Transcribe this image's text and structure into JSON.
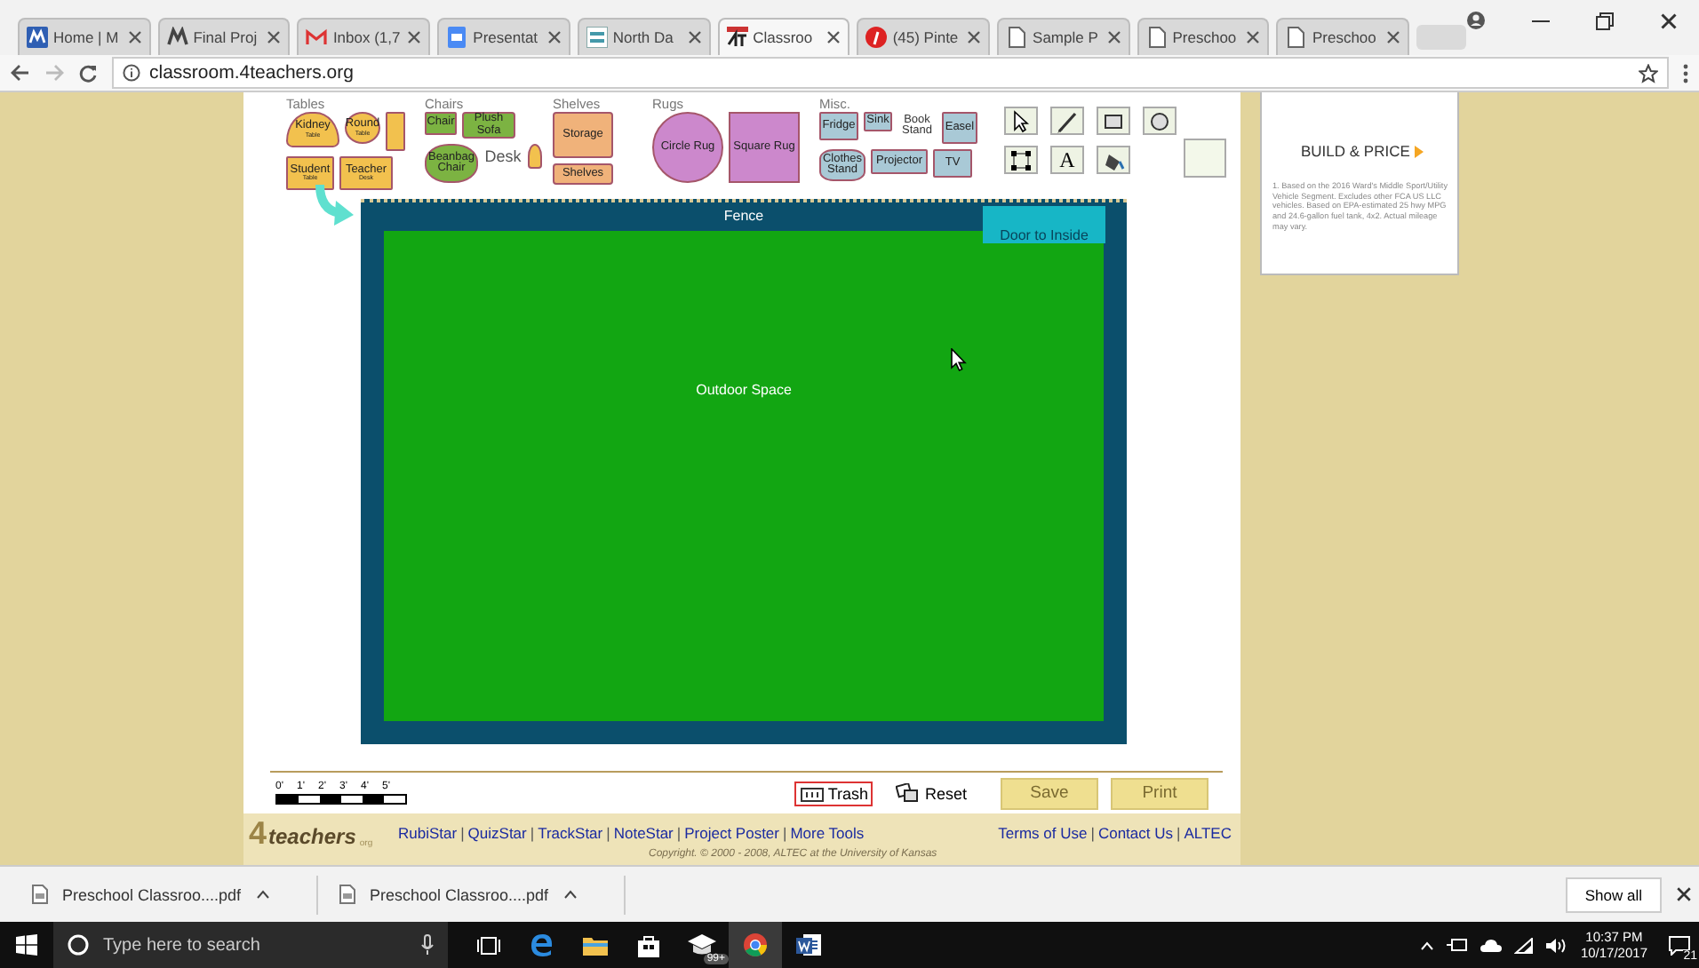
{
  "browser": {
    "tabs": [
      {
        "title": "Home | M",
        "selected": false
      },
      {
        "title": "Final Proj",
        "selected": false
      },
      {
        "title": "Inbox (1,7",
        "selected": false
      },
      {
        "title": "Presentat",
        "selected": false
      },
      {
        "title": "North Da",
        "selected": false
      },
      {
        "title": "Classroo",
        "selected": true
      },
      {
        "title": "(45) Pinte",
        "selected": false
      },
      {
        "title": "Sample P",
        "selected": false
      },
      {
        "title": "Preschoo",
        "selected": false
      },
      {
        "title": "Preschoo",
        "selected": false
      }
    ],
    "url": "classroom.4teachers.org"
  },
  "palette": {
    "categories": [
      {
        "label": "Tables",
        "pieces": [
          {
            "kind": "kidney-table",
            "label": "Kidney",
            "sublabel": "Table"
          },
          {
            "kind": "round-table",
            "label": "Round",
            "sublabel": "Table"
          },
          {
            "kind": "computer-table"
          },
          {
            "kind": "student-table",
            "label": "Student",
            "sublabel": "Table"
          },
          {
            "kind": "teacher-desk",
            "label": "Teacher",
            "sublabel": "Desk"
          }
        ]
      },
      {
        "label": "Chairs",
        "pieces": [
          {
            "kind": "chair",
            "label": "Chair"
          },
          {
            "kind": "sofa",
            "label": "Plush Sofa"
          },
          {
            "kind": "beanbag",
            "label": "Beanbag Chair"
          },
          {
            "kind": "desk",
            "label": "Desk"
          },
          {
            "kind": "rocker"
          }
        ]
      },
      {
        "label": "Shelves",
        "pieces": [
          {
            "kind": "storage",
            "label": "Storage"
          },
          {
            "kind": "shelves",
            "label": "Shelves"
          }
        ]
      },
      {
        "label": "Rugs",
        "pieces": [
          {
            "kind": "circle-rug",
            "label": "Circle Rug"
          },
          {
            "kind": "square-rug",
            "label": "Square Rug"
          }
        ]
      },
      {
        "label": "Misc.",
        "pieces": [
          {
            "kind": "fridge",
            "label": "Fridge"
          },
          {
            "kind": "sink",
            "label": "Sink"
          },
          {
            "kind": "book-stand",
            "label": "Book Stand"
          },
          {
            "kind": "easel",
            "label": "Easel"
          },
          {
            "kind": "clothes-stand",
            "label": "Clothes Stand"
          },
          {
            "kind": "projector",
            "label": "Projector"
          },
          {
            "kind": "tv",
            "label": "TV"
          }
        ]
      }
    ],
    "tools": [
      {
        "kind": "pointer"
      },
      {
        "kind": "brush"
      },
      {
        "kind": "rectangle"
      },
      {
        "kind": "ellipse"
      },
      {
        "kind": "select"
      },
      {
        "kind": "text",
        "label": "A"
      },
      {
        "kind": "fill"
      }
    ]
  },
  "canvas": {
    "fence_label": "Fence",
    "door_label": "Door to Inside",
    "area_label": "Outdoor Space"
  },
  "scale": {
    "labels": [
      "0'",
      "1'",
      "2'",
      "3'",
      "4'",
      "5'"
    ]
  },
  "actions": [
    {
      "kind": "trash",
      "label": "Trash"
    },
    {
      "kind": "reset",
      "label": "Reset"
    },
    {
      "kind": "button",
      "label": "Save"
    },
    {
      "kind": "button",
      "label": "Print"
    }
  ],
  "footer": {
    "logo": {
      "numeral": "4",
      "word": "teachers",
      "suffix": "org"
    },
    "nav": [
      {
        "kind": "link",
        "label": "RubiStar"
      },
      {
        "kind": "separator",
        "label": "|"
      },
      {
        "kind": "link",
        "label": "QuizStar"
      },
      {
        "kind": "separator",
        "label": "|"
      },
      {
        "kind": "link",
        "label": "TrackStar"
      },
      {
        "kind": "separator",
        "label": "|"
      },
      {
        "kind": "link",
        "label": "NoteStar"
      },
      {
        "kind": "separator",
        "label": "|"
      },
      {
        "kind": "link",
        "label": "Project Poster"
      },
      {
        "kind": "separator",
        "label": "|"
      },
      {
        "kind": "link",
        "label": "More Tools"
      }
    ],
    "right_nav": [
      {
        "kind": "link",
        "label": "Terms of Use"
      },
      {
        "kind": "separator",
        "label": "|"
      },
      {
        "kind": "link",
        "label": "Contact Us"
      },
      {
        "kind": "separator",
        "label": "|"
      },
      {
        "kind": "link",
        "label": "ALTEC"
      }
    ],
    "copyright": "Copyright. © 2000 - 2008, ALTEC at the University of Kansas"
  },
  "ad": {
    "heading": "BUILD & PRICE",
    "fine_print": "1. Based on the 2016 Ward's Middle Sport/Utility Vehicle Segment. Excludes other FCA US LLC vehicles. Based on EPA-estimated 25 hwy MPG and 24.6-gallon fuel tank, 4x2. Actual mileage may vary."
  },
  "downloads": {
    "items": [
      "Preschool Classroo....pdf",
      "Preschool Classroo....pdf"
    ],
    "show_all": "Show all"
  },
  "taskbar": {
    "search_placeholder": "Type here to search",
    "mail_badge": "99+",
    "time": "10:37 PM",
    "date": "10/17/2017",
    "notifications": "21"
  }
}
